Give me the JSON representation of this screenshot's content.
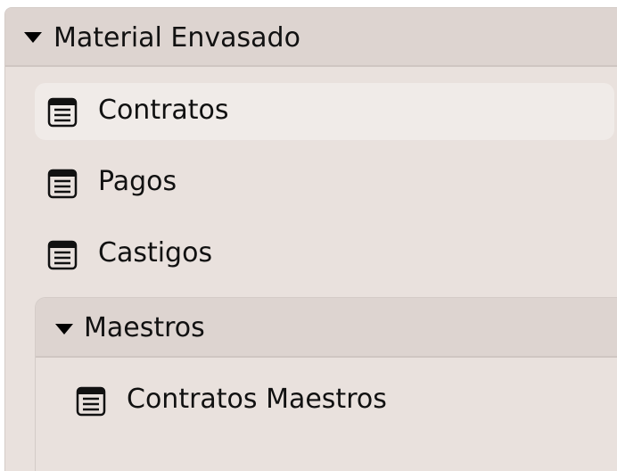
{
  "section": {
    "title": "Material Envasado",
    "expanded": true,
    "icon": "triangle-down-icon",
    "items": [
      {
        "label": "Contratos",
        "icon": "list-document-icon",
        "selected": true
      },
      {
        "label": "Pagos",
        "icon": "list-document-icon",
        "selected": false
      },
      {
        "label": "Castigos",
        "icon": "list-document-icon",
        "selected": false
      }
    ],
    "subgroup": {
      "title": "Maestros",
      "expanded": true,
      "icon": "triangle-down-icon",
      "items": [
        {
          "label": "Contratos Maestros",
          "icon": "list-document-icon",
          "selected": false
        }
      ]
    }
  },
  "colors": {
    "panel_background": "#e9e1dd",
    "header_background": "#ddd4d0",
    "selected_background": "#f0ebe8",
    "text": "#111111"
  }
}
